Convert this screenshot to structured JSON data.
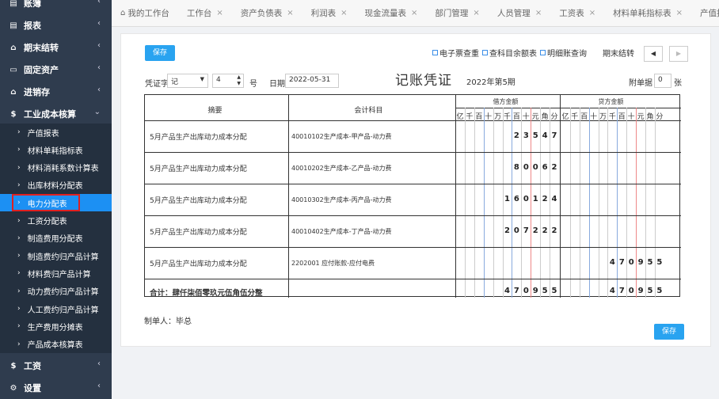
{
  "sidebar": {
    "top_items": [
      {
        "label": "账簿",
        "icon": "book-icon",
        "glyph": "▤"
      },
      {
        "label": "报表",
        "icon": "report-icon",
        "glyph": "▤"
      },
      {
        "label": "期末结转",
        "icon": "home-icon",
        "glyph": "⌂"
      },
      {
        "label": "固定资产",
        "icon": "monitor-icon",
        "glyph": "▭"
      },
      {
        "label": "进销存",
        "icon": "home-icon",
        "glyph": "⌂"
      },
      {
        "label": "工业成本核算",
        "icon": "dollar-icon",
        "glyph": "$"
      }
    ],
    "sub_items": [
      {
        "label": "产值报表"
      },
      {
        "label": "材料单耗指标表"
      },
      {
        "label": "材料消耗系数计算表"
      },
      {
        "label": "出库材料分配表"
      },
      {
        "label": "电力分配表"
      },
      {
        "label": "工资分配表"
      },
      {
        "label": "制造费用分配表"
      },
      {
        "label": "制造费约归产品计算"
      },
      {
        "label": "材料费归产品计算"
      },
      {
        "label": "动力费约归产品计算"
      },
      {
        "label": "人工费约归产品计算"
      },
      {
        "label": "生产费用分摊表"
      },
      {
        "label": "产品成本核算表"
      }
    ],
    "active_sub": "电力分配表",
    "bottom_items": [
      {
        "label": "工资",
        "icon": "dollar-icon",
        "glyph": "$"
      },
      {
        "label": "设置",
        "icon": "settings-icon",
        "glyph": "⚙"
      }
    ]
  },
  "tabs": [
    {
      "label": "我的工作台",
      "closable": false
    },
    {
      "label": "工作台",
      "closable": true
    },
    {
      "label": "资产负债表",
      "closable": true
    },
    {
      "label": "利润表",
      "closable": true
    },
    {
      "label": "现金流量表",
      "closable": true
    },
    {
      "label": "部门管理",
      "closable": true
    },
    {
      "label": "人员管理",
      "closable": true
    },
    {
      "label": "工资表",
      "closable": true
    },
    {
      "label": "材料单耗指标表",
      "closable": true
    },
    {
      "label": "产值报",
      "closable": false
    }
  ],
  "toolbar": {
    "save_label": "保存",
    "links": [
      "电子票查重",
      "查科目余额表",
      "明细账查询"
    ],
    "period_close": "期末结转",
    "prev_glyph": "◀",
    "next_glyph": "▶"
  },
  "voucher": {
    "title": "记账凭证",
    "period": "2022年第5期",
    "word_label": "凭证字",
    "word_value": "记",
    "number_value": "4",
    "number_suffix": "号",
    "date_label": "日期",
    "date_value": "2022-05-31",
    "attach_label": "附单据",
    "attach_value": "0",
    "attach_unit": "张",
    "col_summary": "摘要",
    "col_account": "会计科目",
    "col_debit": "借方金额",
    "col_credit": "贷方金额",
    "units": [
      "亿",
      "千",
      "百",
      "十",
      "万",
      "千",
      "百",
      "十",
      "元",
      "角",
      "分"
    ],
    "rows": [
      {
        "summary": "5月产品生产出库动力成本分配",
        "account": "40010102生产成本-甲产品-动力费",
        "debit": "23547",
        "credit": ""
      },
      {
        "summary": "5月产品生产出库动力成本分配",
        "account": "40010202生产成本-乙产品-动力费",
        "debit": "80062",
        "credit": ""
      },
      {
        "summary": "5月产品生产出库动力成本分配",
        "account": "40010302生产成本-丙产品-动力费",
        "debit": "160124",
        "credit": ""
      },
      {
        "summary": "5月产品生产出库动力成本分配",
        "account": "40010402生产成本-丁产品-动力费",
        "debit": "207222",
        "credit": ""
      },
      {
        "summary": "5月产品生产出库动力成本分配",
        "account": "2202001 应付账款-应付电费",
        "debit": "",
        "credit": "470955"
      }
    ],
    "total_label": "合计：肆仟柒佰零玖元伍角伍分整",
    "total_debit": "470955",
    "total_credit": "470955",
    "maker": "制单人：毕总",
    "save_bottom": "保存"
  }
}
